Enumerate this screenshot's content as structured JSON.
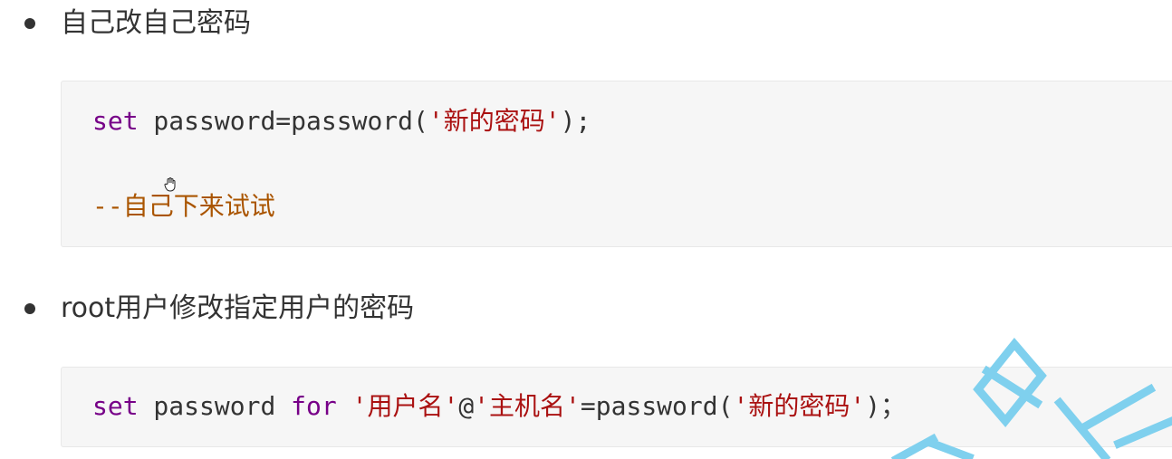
{
  "section1": {
    "heading": "自己改自己密码",
    "code": {
      "line1": {
        "keyword": "set",
        "plain_before": " password=password(",
        "string": "'新的密码'",
        "plain_after": ");"
      },
      "line2": {
        "comment": "--自己下来试试"
      }
    }
  },
  "section2": {
    "heading": "root用户修改指定用户的密码",
    "code": {
      "line1": {
        "keyword1": "set",
        "plain1": " password ",
        "keyword2": "for",
        "plain2": " ",
        "string1": "'用户名'",
        "plain3": "@",
        "string2": "'主机名'",
        "plain4": "=password(",
        "string3": "'新的密码'",
        "plain5": ")；"
      }
    }
  },
  "colors": {
    "keyword": "#770088",
    "string": "#aa1111",
    "comment": "#aa5500",
    "code_bg": "#f6f6f6",
    "watermark": "#7fd0ee"
  }
}
